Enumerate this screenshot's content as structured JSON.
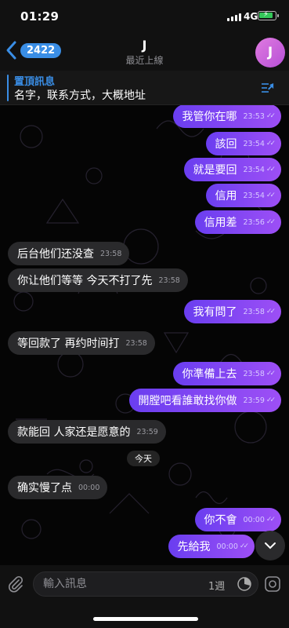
{
  "status": {
    "time": "01:29",
    "network": "4G",
    "battery_color": "#34c759"
  },
  "header": {
    "back_badge": "2422",
    "title": "J",
    "subtitle": "最近上線",
    "avatar_letter": "J",
    "back_icon": "chevron-left-icon"
  },
  "pinned": {
    "title": "置頂訊息",
    "text": "名字，联系方式，大概地址",
    "icon": "pin-list-icon"
  },
  "messages": [
    {
      "side": "out",
      "text": "我管你在哪",
      "time": "23:53"
    },
    {
      "side": "out",
      "text": "該回",
      "time": "23:54"
    },
    {
      "side": "out",
      "text": "就是要回",
      "time": "23:54"
    },
    {
      "side": "out",
      "text": "信用",
      "time": "23:54"
    },
    {
      "side": "out",
      "text": "信用差",
      "time": "23:56"
    },
    {
      "side": "in",
      "text": "后台他们还没查",
      "time": "23:58"
    },
    {
      "side": "in",
      "text": "你让他们等等 今天不打了先",
      "time": "23:58"
    },
    {
      "side": "out",
      "text": "我有問了",
      "time": "23:58"
    },
    {
      "side": "in",
      "text": "等回款了 再约时间打",
      "time": "23:58"
    },
    {
      "side": "out",
      "text": "你準備上去",
      "time": "23:58"
    },
    {
      "side": "out",
      "text": "開膛吧看誰敢找你做",
      "time": "23:59"
    },
    {
      "side": "in",
      "text": "款能回 人家还是愿意的",
      "time": "23:59"
    },
    {
      "side": "in",
      "text": "确实慢了点",
      "time": "00:00"
    },
    {
      "side": "out",
      "text": "你不會",
      "time": "00:00"
    },
    {
      "side": "out",
      "text": "先給我",
      "time": "00:00"
    }
  ],
  "date_divider": "今天",
  "input": {
    "placeholder": "輸入訊息",
    "timer_label": "1週"
  },
  "colors": {
    "accent": "#3a8ee6",
    "outgoing_start": "#6a3ef0",
    "outgoing_end": "#9d4ff5",
    "incoming": "#2a2a2c"
  }
}
